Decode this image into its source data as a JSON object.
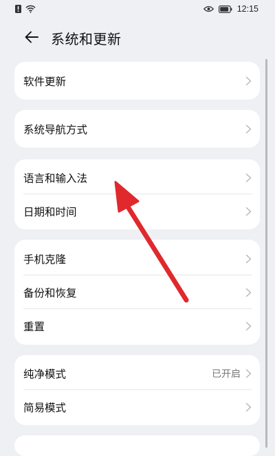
{
  "status_bar": {
    "time": "12:15",
    "icons": [
      "notification-icon",
      "wifi-icon",
      "eye-icon",
      "battery-icon"
    ]
  },
  "header": {
    "back_icon": "arrow-left-icon",
    "title": "系统和更新"
  },
  "cards": [
    {
      "rows": [
        {
          "label": "软件更新"
        }
      ]
    },
    {
      "rows": [
        {
          "label": "系统导航方式"
        }
      ]
    },
    {
      "rows": [
        {
          "label": "语言和输入法"
        },
        {
          "label": "日期和时间"
        }
      ]
    },
    {
      "rows": [
        {
          "label": "手机克隆"
        },
        {
          "label": "备份和恢复"
        },
        {
          "label": "重置"
        }
      ]
    },
    {
      "rows": [
        {
          "label": "纯净模式",
          "value": "已开启"
        },
        {
          "label": "简易模式"
        }
      ]
    }
  ],
  "annotation": {
    "icon": "red-arrow-icon",
    "color": "#e0282d"
  },
  "colors": {
    "background": "#eef0f3",
    "card": "#ffffff",
    "chevron": "#b5b5b5"
  }
}
